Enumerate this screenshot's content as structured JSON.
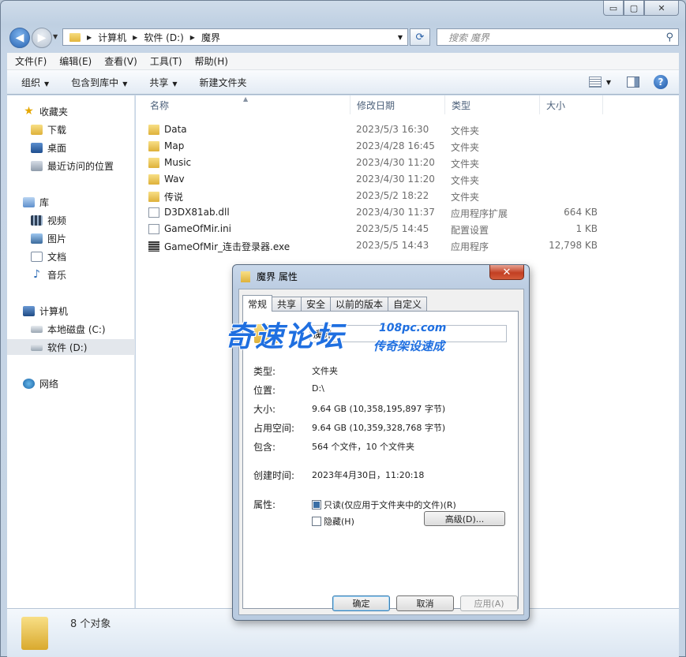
{
  "window": {
    "address": {
      "crumbs": [
        "计算机",
        "软件 (D:)",
        "魔界"
      ]
    },
    "search_placeholder": "搜索 魔界",
    "caption": {
      "minimize": "▭",
      "maximize": "▢",
      "close": "✕"
    }
  },
  "menubar": [
    "文件(F)",
    "编辑(E)",
    "查看(V)",
    "工具(T)",
    "帮助(H)"
  ],
  "commandbar": {
    "organize": "组织",
    "include_library": "包含到库中",
    "share": "共享",
    "new_folder": "新建文件夹"
  },
  "sidebar": {
    "favorites": {
      "label": "收藏夹",
      "items": [
        "下载",
        "桌面",
        "最近访问的位置"
      ]
    },
    "libraries": {
      "label": "库",
      "items": [
        "视频",
        "图片",
        "文档",
        "音乐"
      ]
    },
    "computer": {
      "label": "计算机",
      "items": [
        "本地磁盘 (C:)",
        "软件 (D:)"
      ]
    },
    "network": {
      "label": "网络"
    }
  },
  "columns": {
    "name": "名称",
    "date": "修改日期",
    "type": "类型",
    "size": "大小"
  },
  "files": [
    {
      "name": "Data",
      "date": "2023/5/3 16:30",
      "type": "文件夹",
      "size": "",
      "icon": "folder"
    },
    {
      "name": "Map",
      "date": "2023/4/28 16:45",
      "type": "文件夹",
      "size": "",
      "icon": "folder"
    },
    {
      "name": "Music",
      "date": "2023/4/30 11:20",
      "type": "文件夹",
      "size": "",
      "icon": "folder"
    },
    {
      "name": "Wav",
      "date": "2023/4/30 11:20",
      "type": "文件夹",
      "size": "",
      "icon": "folder"
    },
    {
      "name": "传说",
      "date": "2023/5/2 18:22",
      "type": "文件夹",
      "size": "",
      "icon": "folder"
    },
    {
      "name": "D3DX81ab.dll",
      "date": "2023/4/30 11:37",
      "type": "应用程序扩展",
      "size": "664 KB",
      "icon": "dll"
    },
    {
      "name": "GameOfMir.ini",
      "date": "2023/5/5 14:45",
      "type": "配置设置",
      "size": "1 KB",
      "icon": "ini"
    },
    {
      "name": "GameOfMir_连击登录器.exe",
      "date": "2023/5/5 14:43",
      "type": "应用程序",
      "size": "12,798 KB",
      "icon": "exe"
    }
  ],
  "status": {
    "count": "8 个对象"
  },
  "dialog": {
    "title": "魔界 属性",
    "tabs": [
      "常规",
      "共享",
      "安全",
      "以前的版本",
      "自定义"
    ],
    "folder_name": "魔界",
    "props": {
      "type_label": "类型:",
      "type_value": "文件夹",
      "location_label": "位置:",
      "location_value": "D:\\",
      "size_label": "大小:",
      "size_value": "9.64 GB (10,358,195,897 字节)",
      "disk_label": "占用空间:",
      "disk_value": "9.64 GB (10,359,328,768 字节)",
      "contains_label": "包含:",
      "contains_value": "564 个文件，10 个文件夹",
      "created_label": "创建时间:",
      "created_value": "2023年4月30日，11:20:18",
      "attrs_label": "属性:",
      "readonly_label": "只读(仅应用于文件夹中的文件)(R)",
      "hidden_label": "隐藏(H)",
      "advanced_button": "高级(D)..."
    },
    "buttons": {
      "ok": "确定",
      "cancel": "取消",
      "apply": "应用(A)"
    }
  },
  "watermark": {
    "big": "奇速论坛",
    "url": "108pc.com",
    "slogan": "传奇架设速成"
  }
}
